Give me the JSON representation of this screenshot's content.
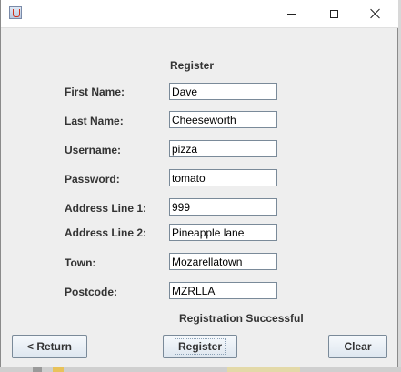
{
  "window": {
    "title": "",
    "controls": {
      "minimize_icon": "minimize-icon",
      "maximize_icon": "maximize-icon",
      "close_icon": "close-icon"
    }
  },
  "form": {
    "heading": "Register",
    "fields": [
      {
        "label": "First Name:",
        "value": "Dave"
      },
      {
        "label": "Last Name:",
        "value": "Cheeseworth"
      },
      {
        "label": "Username:",
        "value": "pizza"
      },
      {
        "label": "Password:",
        "value": "tomato"
      },
      {
        "label": "Address Line 1:",
        "value": "999"
      },
      {
        "label": "Address Line 2:",
        "value": "Pineapple lane"
      },
      {
        "label": "Town:",
        "value": "Mozarellatown"
      },
      {
        "label": "Postcode:",
        "value": "MZRLLA"
      }
    ],
    "status": "Registration Successful"
  },
  "buttons": {
    "return_label": "< Return",
    "register_label": "Register",
    "clear_label": "Clear"
  },
  "colors": {
    "background": "#eeeeee",
    "button_top": "#f6f9fc",
    "button_bottom": "#dde6ef",
    "border": "#7a8a99"
  }
}
